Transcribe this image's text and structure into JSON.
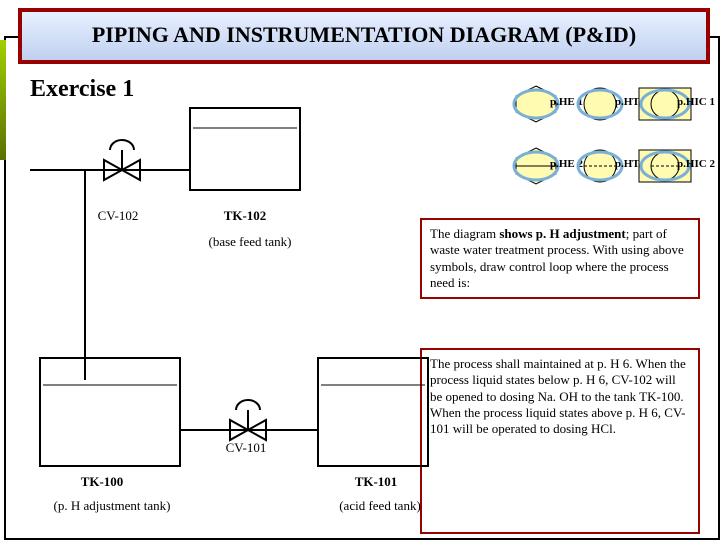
{
  "title": "PIPING AND INSTRUMENTATION DIAGRAM (P&ID)",
  "exercise": "Exercise 1",
  "legend": {
    "r1": [
      "p.HE 1",
      "p.HT 1",
      "p.HIC 1"
    ],
    "r2": [
      "p.HE 2",
      "p.HT 2",
      "p.HIC 2"
    ]
  },
  "labels": {
    "cv102": "CV-102",
    "tk102": "TK-102",
    "tk102sub": "(base feed tank)",
    "tk100": "TK-100",
    "tk100sub": "(p. H adjustment tank)",
    "cv101": "CV-101",
    "tk101": "TK-101",
    "tk101sub": "(acid feed tank)"
  },
  "box1_parts": {
    "a": "The diagram ",
    "b": "shows p. H adjustment",
    "c": "; part of waste water treatment process. With using above symbols, draw control loop where the process need is:"
  },
  "box2": "The process shall maintained at p. H 6. When the process liquid states below p. H 6, CV-102 will be opened to dosing Na. OH to the tank TK-100. When the process liquid states above p. H 6, CV-101 will be operated to dosing HCl."
}
